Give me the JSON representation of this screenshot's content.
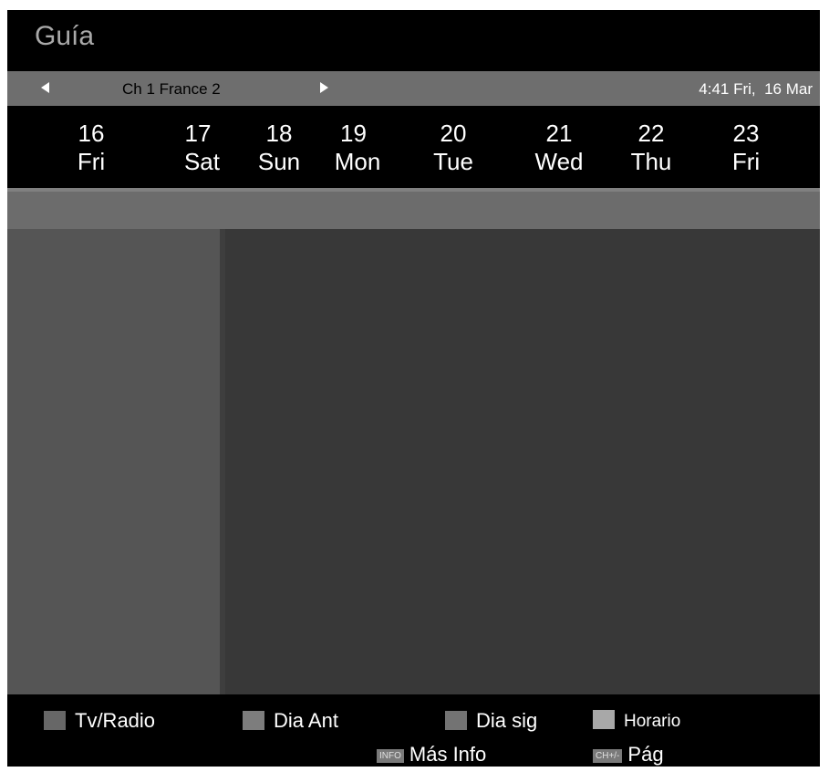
{
  "header": {
    "title": "Guía"
  },
  "channel_bar": {
    "channel": "Ch 1 France 2",
    "time": "4:41",
    "date": "Fri,  16 Mar"
  },
  "days": [
    {
      "num": "16",
      "name": "Fri"
    },
    {
      "num": "17",
      "name": "Sat"
    },
    {
      "num": "18",
      "name": "Sun"
    },
    {
      "num": "19",
      "name": "Mon"
    },
    {
      "num": "20",
      "name": "Tue"
    },
    {
      "num": "21",
      "name": "Wed"
    },
    {
      "num": "22",
      "name": "Thu"
    },
    {
      "num": "23",
      "name": "Fri"
    }
  ],
  "footer": {
    "tv_radio": "Tv/Radio",
    "prev_day": "Dia Ant",
    "next_day": "Dia sig",
    "schedule": "Horario",
    "info_key": "INFO",
    "more_info": "Más Info",
    "page_key": "CH+/-",
    "page": "Pág"
  },
  "colors": {
    "background": "#000000",
    "channel_bar": "#6e6e6e",
    "list_panel": "#555555",
    "detail_panel": "#383838",
    "title": "#a9a9a9"
  }
}
